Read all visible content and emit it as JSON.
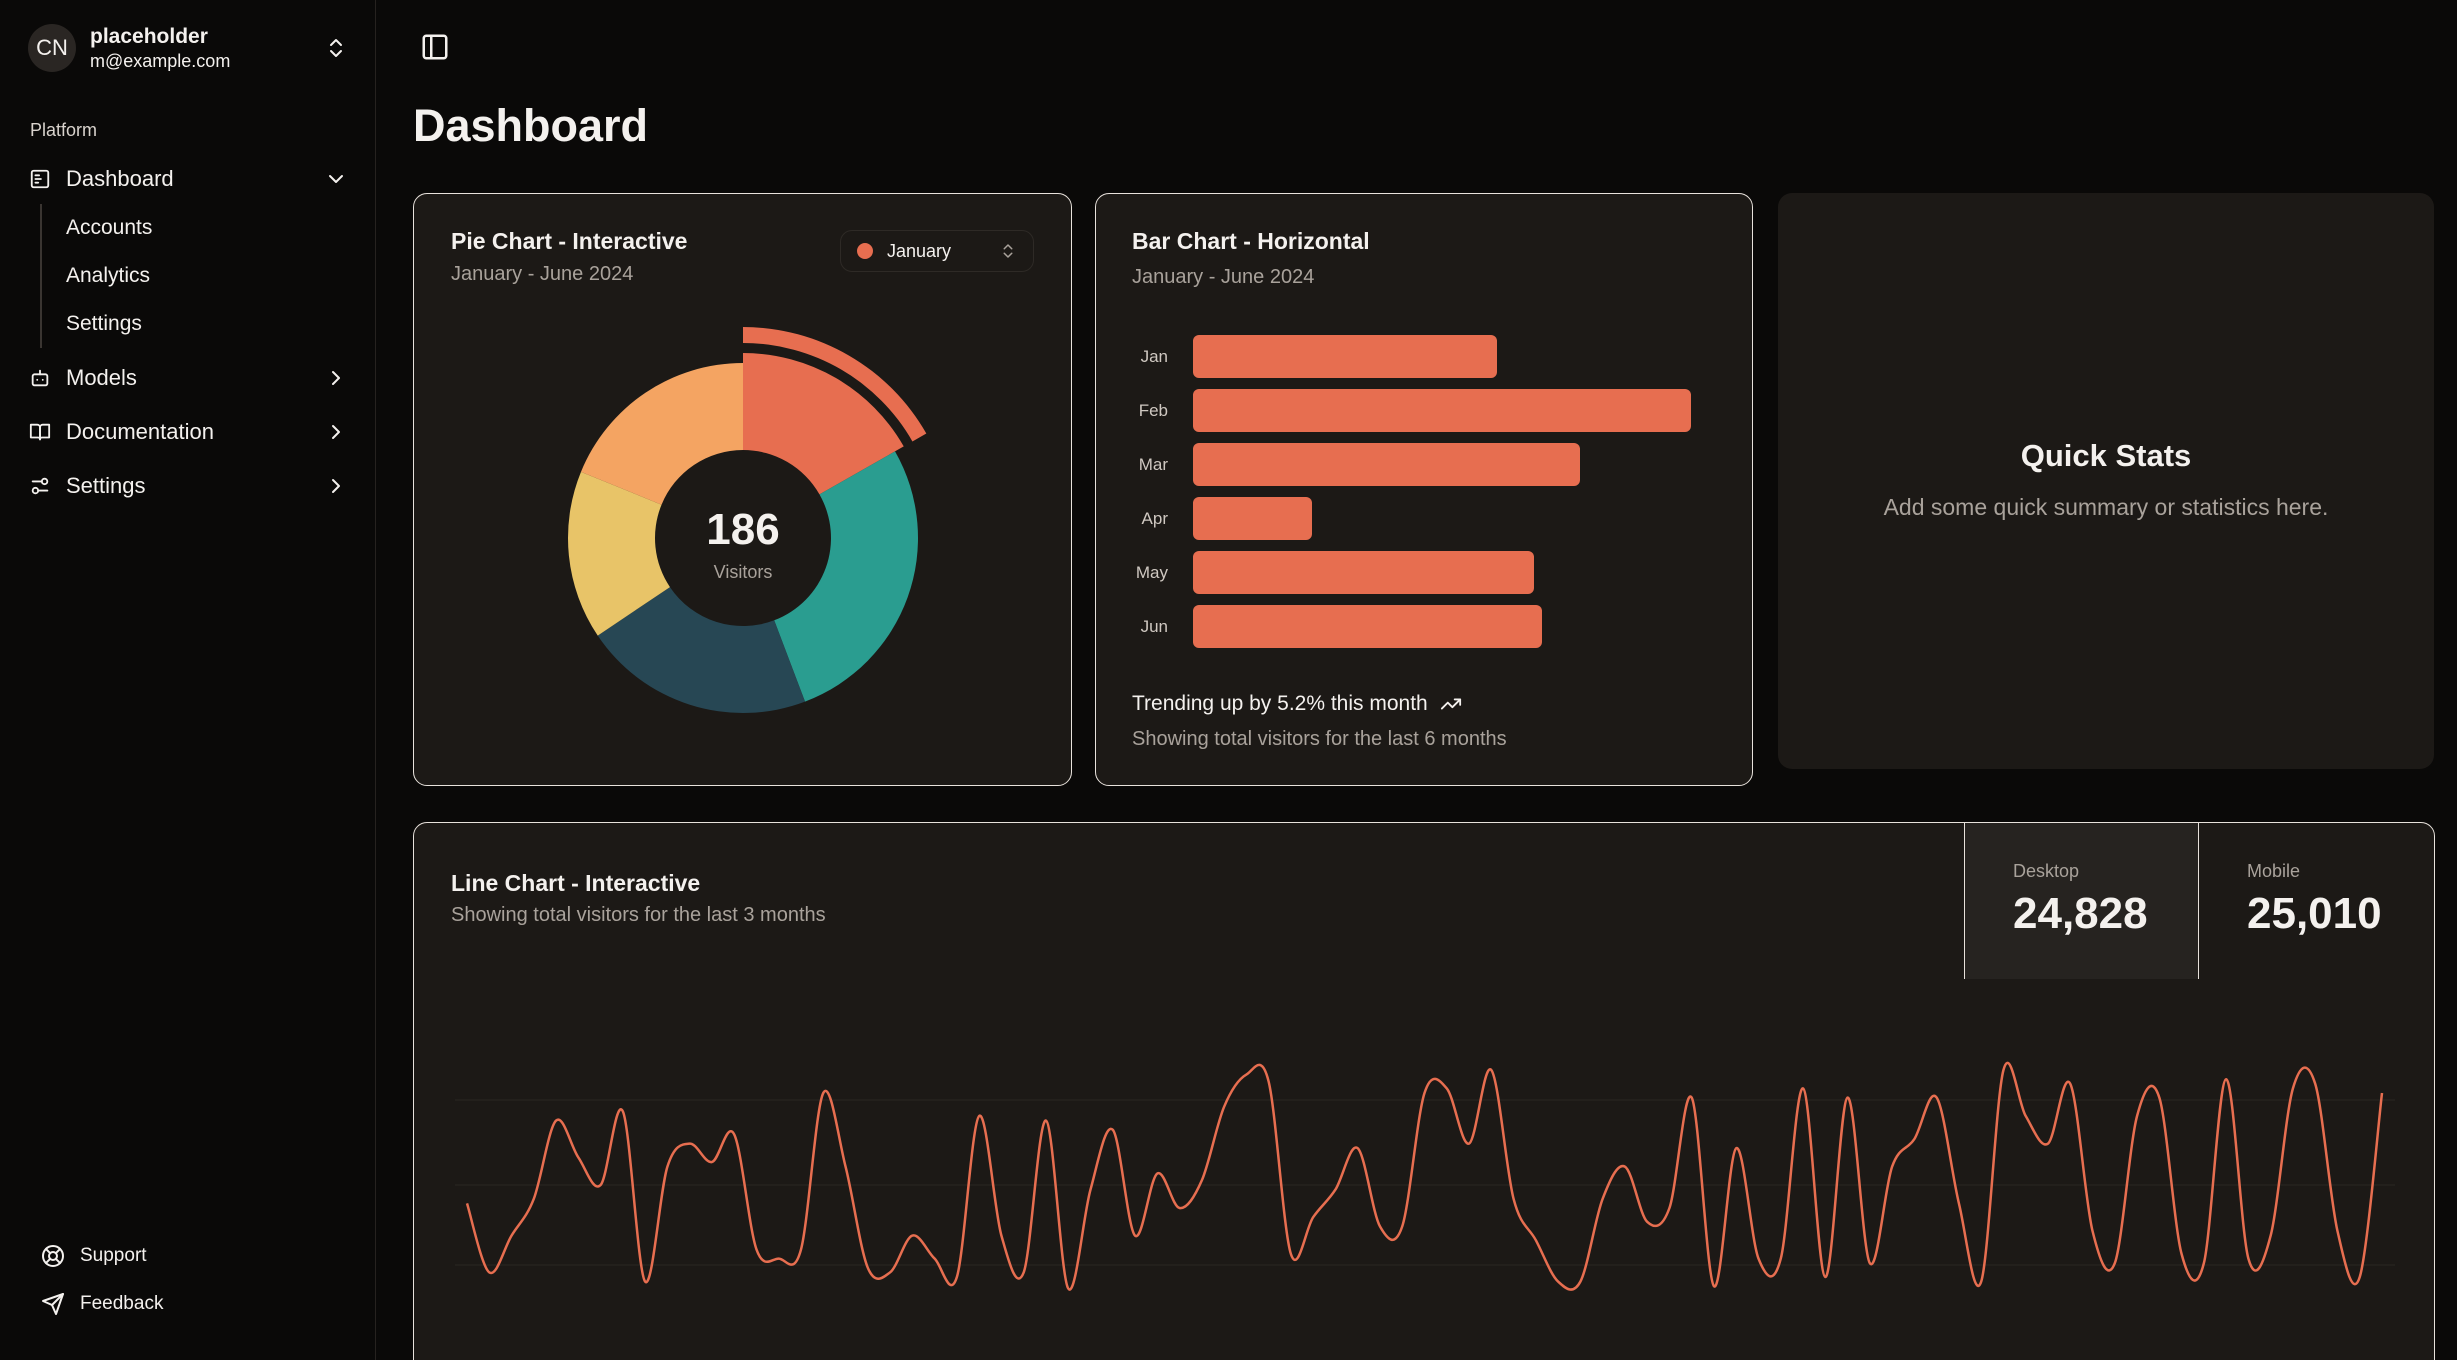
{
  "user": {
    "initials": "CN",
    "name": "placeholder",
    "email": "m@example.com"
  },
  "sidebar": {
    "group_label": "Platform",
    "items": [
      {
        "label": "Dashboard",
        "icon": "dashboard-icon",
        "expanded": true
      },
      {
        "label": "Models",
        "icon": "bot-icon",
        "expanded": false
      },
      {
        "label": "Documentation",
        "icon": "book-icon",
        "expanded": false
      },
      {
        "label": "Settings",
        "icon": "sliders-icon",
        "expanded": false
      }
    ],
    "sub_items": [
      "Accounts",
      "Analytics",
      "Settings"
    ],
    "footer": [
      {
        "label": "Support",
        "icon": "life-buoy-icon"
      },
      {
        "label": "Feedback",
        "icon": "send-icon"
      }
    ]
  },
  "page": {
    "title": "Dashboard"
  },
  "pie_card": {
    "title": "Pie Chart - Interactive",
    "subtitle": "January - June 2024",
    "select_value": "January",
    "center_value": "186",
    "center_label": "Visitors"
  },
  "bar_card": {
    "title": "Bar Chart - Horizontal",
    "subtitle": "January - June 2024",
    "trend_text": "Trending up by 5.2% this month",
    "footer_text": "Showing total visitors for the last 6 months"
  },
  "quick_stats": {
    "title": "Quick Stats",
    "subtitle": "Add some quick summary or statistics here."
  },
  "line_card": {
    "title": "Line Chart - Interactive",
    "subtitle": "Showing total visitors for the last 3 months",
    "stats": [
      {
        "label": "Desktop",
        "value": "24,828",
        "active": true
      },
      {
        "label": "Mobile",
        "value": "25,010",
        "active": false
      }
    ]
  },
  "colors": {
    "accent": "#e76e50",
    "teal": "#2a9d90",
    "slate": "#274754",
    "yellow": "#e8c468",
    "card": "#1c1916"
  },
  "chart_data": [
    {
      "type": "pie",
      "variant": "donut",
      "categories": [
        "January",
        "February",
        "March",
        "April",
        "May"
      ],
      "values": [
        186,
        305,
        237,
        173,
        209
      ],
      "active": "January",
      "colors": [
        "#e76e50",
        "#2a9d90",
        "#274754",
        "#e8c468",
        "#f4a462"
      ]
    },
    {
      "type": "bar",
      "orientation": "horizontal",
      "categories": [
        "Jan",
        "Feb",
        "Mar",
        "Apr",
        "May",
        "Jun"
      ],
      "values": [
        186,
        305,
        237,
        73,
        209,
        214
      ],
      "xlim": [
        0,
        305
      ]
    },
    {
      "type": "line",
      "series": [
        {
          "values": [
            42,
            12,
            28,
            44,
            78,
            62,
            50,
            82,
            8,
            58,
            68,
            60,
            72,
            22,
            18,
            22,
            90,
            58,
            14,
            12,
            28,
            18,
            10,
            80,
            28,
            12,
            78,
            5,
            48,
            74,
            28,
            55,
            40,
            52,
            84,
            98,
            95,
            20,
            36,
            48,
            66,
            32,
            32,
            90,
            92,
            68,
            100,
            44,
            26,
            8,
            8,
            44,
            58,
            34,
            40,
            88,
            6,
            66,
            18,
            18,
            92,
            10,
            88,
            16,
            58,
            70,
            88,
            42,
            8,
            100,
            80,
            68,
            94,
            30,
            16,
            80,
            88,
            20,
            16,
            96,
            18,
            28,
            92,
            94,
            30,
            10,
            90
          ]
        }
      ],
      "ylim": [
        0,
        100
      ],
      "grid": true
    }
  ]
}
